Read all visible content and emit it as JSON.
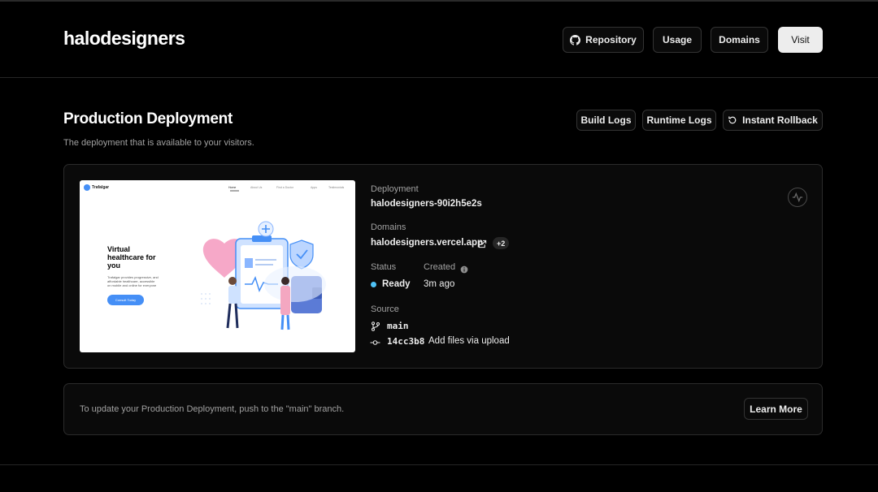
{
  "project": {
    "name": "halodesigners"
  },
  "header_actions": {
    "repository": "Repository",
    "usage": "Usage",
    "domains": "Domains",
    "visit": "Visit"
  },
  "section": {
    "title": "Production Deployment",
    "subtitle": "The deployment that is available to your visitors."
  },
  "section_actions": {
    "build_logs": "Build Logs",
    "runtime_logs": "Runtime Logs",
    "instant_rollback": "Instant Rollback"
  },
  "preview": {
    "brand": "Trafalgar",
    "nav": [
      "Home",
      "About Us",
      "Find a Doctor",
      "Apps",
      "Testimonials"
    ],
    "hero_title": [
      "Virtual",
      "healthcare for",
      "you"
    ],
    "hero_text": [
      "Trafalgar provides progressive, and",
      "affordable healthcare, accessible",
      "on mobile and online for everyone"
    ],
    "cta": "Consult Today"
  },
  "deployment": {
    "deployment_label": "Deployment",
    "deployment_id": "halodesigners-90i2h5e2s",
    "domains_label": "Domains",
    "domain": "halodesigners.vercel.app",
    "extra_domains": "+2",
    "status_label": "Status",
    "status": "Ready",
    "status_color": "#4fc3f7",
    "created_label": "Created",
    "created": "3m ago",
    "source_label": "Source",
    "branch": "main",
    "commit_hash": "14cc3b8",
    "commit_message": "Add files via upload"
  },
  "notice": {
    "text": "To update your Production Deployment, push to the \"main\" branch.",
    "learn_more": "Learn More"
  }
}
